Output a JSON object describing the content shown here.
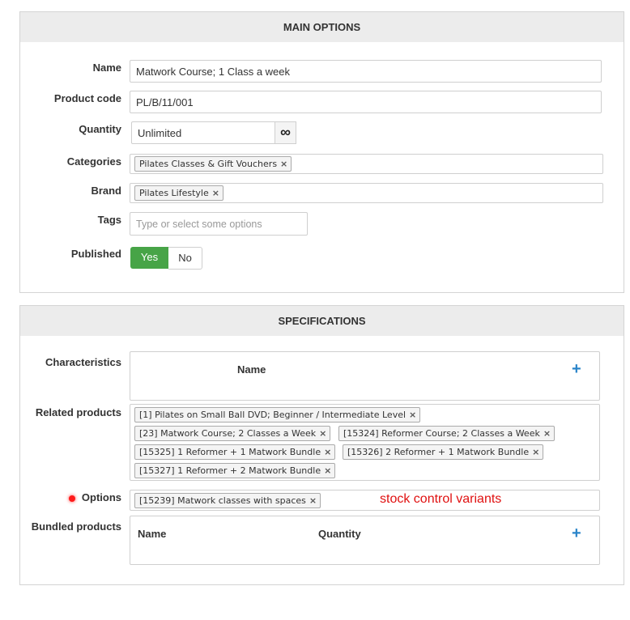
{
  "main_options": {
    "title": "MAIN OPTIONS",
    "name_label": "Name",
    "name_value": "Matwork Course; 1 Class a week",
    "product_code_label": "Product code",
    "product_code_value": "PL/B/11/001",
    "quantity_label": "Quantity",
    "quantity_value": "Unlimited",
    "quantity_unlimited_symbol": "∞",
    "categories_label": "Categories",
    "categories": [
      "Pilates Classes & Gift Vouchers"
    ],
    "brand_label": "Brand",
    "brand": [
      "Pilates Lifestyle"
    ],
    "tags_label": "Tags",
    "tags_placeholder": "Type or select some options",
    "published_label": "Published",
    "published_yes": "Yes",
    "published_no": "No",
    "published_selected": "Yes"
  },
  "specifications": {
    "title": "SPECIFICATIONS",
    "characteristics_label": "Characteristics",
    "characteristics_col_name": "Name",
    "related_label": "Related products",
    "related": [
      "[1] Pilates on Small Ball DVD; Beginner / Intermediate Level",
      "[23] Matwork Course; 2 Classes a Week",
      "[15324] Reformer Course; 2 Classes a Week",
      "[15325] 1 Reformer + 1 Matwork Bundle",
      "[15326] 2 Reformer + 1 Matwork Bundle",
      "[15327] 1 Reformer + 2 Matwork Bundle"
    ],
    "options_label": "Options",
    "options": [
      "[15239] Matwork classes with spaces"
    ],
    "options_annotation": "stock control variants",
    "bundled_label": "Bundled products",
    "bundled_col_name": "Name",
    "bundled_col_quantity": "Quantity"
  },
  "icons": {
    "remove": "×",
    "add": "+"
  },
  "colors": {
    "accent_green": "#47a447",
    "plus_blue": "#2a84c9",
    "annotation_red": "#e01010"
  }
}
